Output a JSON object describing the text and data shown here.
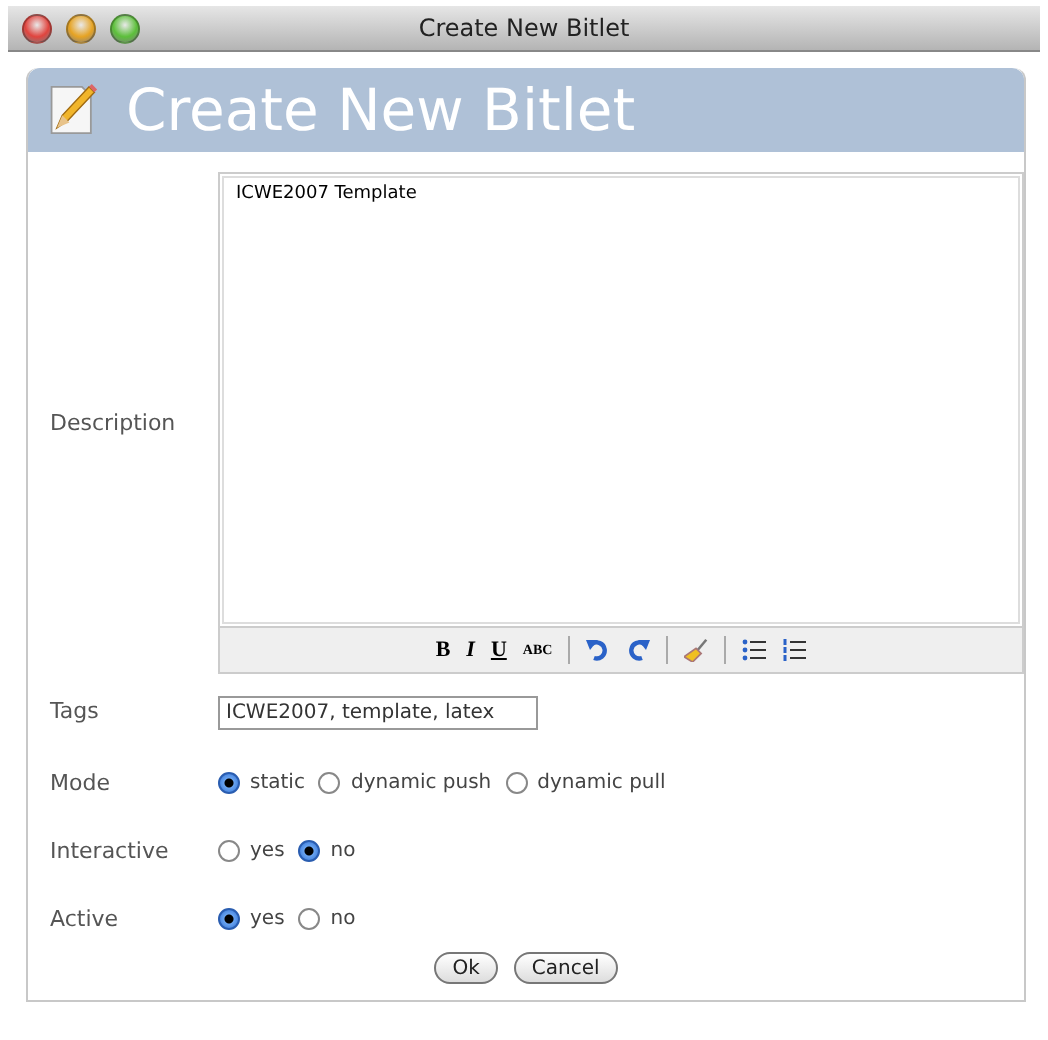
{
  "window": {
    "title": "Create New Bitlet"
  },
  "header": {
    "title": "Create New Bitlet"
  },
  "description": {
    "label": "Description",
    "value": "ICWE2007 Template",
    "toolbar": [
      {
        "kind": "bold",
        "label": "B"
      },
      {
        "kind": "italic",
        "label": "I"
      },
      {
        "kind": "underline",
        "label": "U"
      },
      {
        "kind": "strike",
        "label": "ABC"
      },
      {
        "kind": "separator"
      },
      {
        "kind": "undo"
      },
      {
        "kind": "redo"
      },
      {
        "kind": "separator"
      },
      {
        "kind": "clean"
      },
      {
        "kind": "separator"
      },
      {
        "kind": "bullets"
      },
      {
        "kind": "numbers"
      }
    ]
  },
  "tags": {
    "label": "Tags",
    "value": "ICWE2007, template, latex"
  },
  "radio_groups": [
    {
      "label": "Mode",
      "options": [
        {
          "label": "static",
          "selected": true
        },
        {
          "label": "dynamic push",
          "selected": false
        },
        {
          "label": "dynamic pull",
          "selected": false
        }
      ]
    },
    {
      "label": "Interactive",
      "options": [
        {
          "label": "yes",
          "selected": false
        },
        {
          "label": "no",
          "selected": true
        }
      ]
    },
    {
      "label": "Active",
      "options": [
        {
          "label": "yes",
          "selected": true
        },
        {
          "label": "no",
          "selected": false
        }
      ]
    }
  ],
  "buttons": [
    "Ok",
    "Cancel"
  ]
}
